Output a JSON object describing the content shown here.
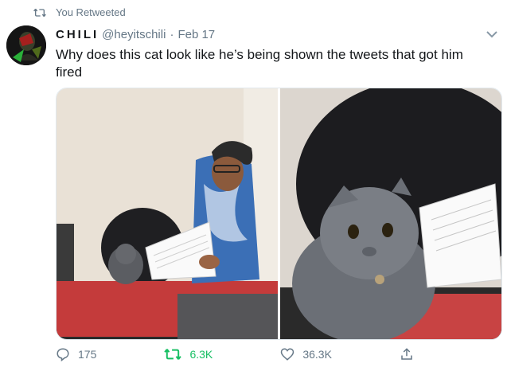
{
  "retweet_notice": "You Retweeted",
  "tweet": {
    "display_name": "CHILI",
    "handle": "@heyitschili",
    "separator": "·",
    "date": "Feb 17",
    "text": "Why does this cat look like he’s being shown the tweets that got him fired"
  },
  "actions": {
    "replies": "175",
    "retweets": "6.3K",
    "likes": "36.3K"
  },
  "colors": {
    "retweet_green": "#17bf63",
    "muted_gray": "#657786"
  },
  "icons": [
    "retweet-icon",
    "chevron-down-icon",
    "reply-icon",
    "like-icon",
    "share-icon"
  ]
}
